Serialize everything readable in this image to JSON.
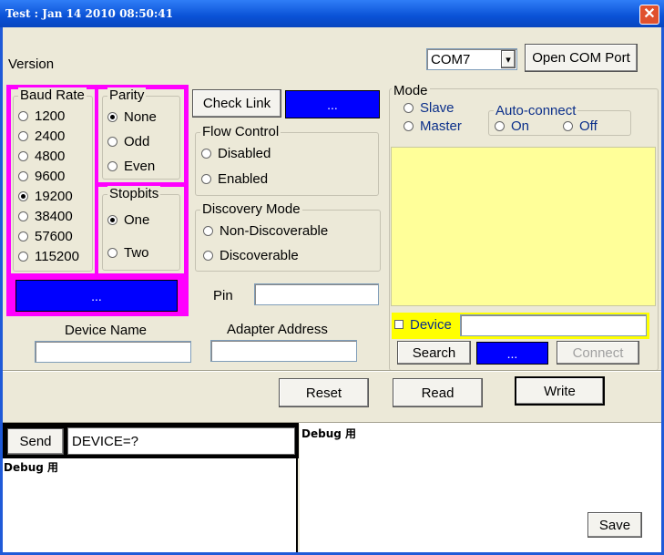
{
  "window": {
    "title": "Test : Jan 14 2010 08:50:41",
    "close_glyph": "✕"
  },
  "version_label": "Version",
  "com_port": {
    "selected": "COM7",
    "dropdown_glyph": "▾",
    "open_label": "Open COM Port"
  },
  "baud_rate": {
    "title": "Baud Rate",
    "options": [
      "1200",
      "2400",
      "4800",
      "9600",
      "19200",
      "38400",
      "57600",
      "115200"
    ],
    "selected": "19200"
  },
  "parity": {
    "title": "Parity",
    "options": [
      "None",
      "Odd",
      "Even"
    ],
    "selected": "None"
  },
  "stopbits": {
    "title": "Stopbits",
    "options": [
      "One",
      "Two"
    ],
    "selected": "One"
  },
  "serial_apply_label": "...",
  "check_link": {
    "label": "Check Link",
    "action_label": "..."
  },
  "flow_control": {
    "title": "Flow Control",
    "options": [
      "Disabled",
      "Enabled"
    ]
  },
  "discovery_mode": {
    "title": "Discovery Mode",
    "options": [
      "Non-Discoverable",
      "Discoverable"
    ]
  },
  "pin": {
    "label": "Pin",
    "value": ""
  },
  "device_name": {
    "label": "Device Name",
    "value": ""
  },
  "adapter_address": {
    "label": "Adapter Address",
    "value": ""
  },
  "mode": {
    "title": "Mode",
    "options": [
      "Slave",
      "Master"
    ]
  },
  "auto_connect": {
    "title": "Auto-connect",
    "options": [
      "On",
      "Off"
    ]
  },
  "device_filter": {
    "label": "Device",
    "value": ""
  },
  "search_label": "Search",
  "search_action_label": "...",
  "connect_label": "Connect",
  "actions": {
    "reset": "Reset",
    "read": "Read",
    "write": "Write"
  },
  "console": {
    "send_label": "Send",
    "command": "DEVICE=?",
    "left_debug": "Debug 用",
    "right_debug": "Debug 用",
    "save_label": "Save"
  },
  "colors": {
    "accent_blue": "#0000ff",
    "highlight": "#ff00ff",
    "list_bg": "#ffff99",
    "device_bar": "#ffff00",
    "titlebar": "#0a52d6"
  }
}
